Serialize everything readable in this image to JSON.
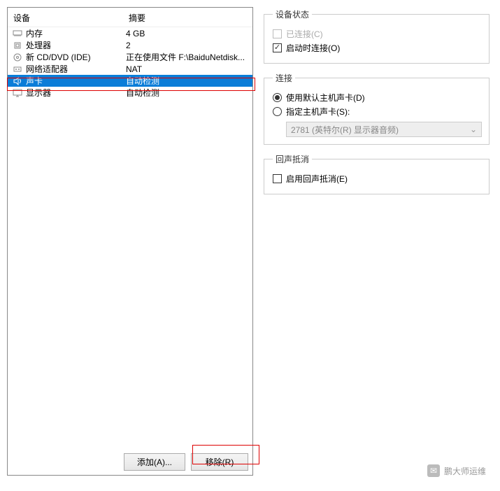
{
  "leftPanel": {
    "headerDevice": "设备",
    "headerSummary": "摘要",
    "rows": [
      {
        "icon": "memory",
        "label": "内存",
        "summary": "4 GB",
        "selected": false
      },
      {
        "icon": "cpu",
        "label": "处理器",
        "summary": "2",
        "selected": false
      },
      {
        "icon": "disc",
        "label": "新 CD/DVD (IDE)",
        "summary": "正在使用文件 F:\\BaiduNetdisk...",
        "selected": false
      },
      {
        "icon": "network",
        "label": "网络适配器",
        "summary": "NAT",
        "selected": false
      },
      {
        "icon": "sound",
        "label": "声卡",
        "summary": "自动检测",
        "selected": true
      },
      {
        "icon": "display",
        "label": "显示器",
        "summary": "自动检测",
        "selected": false
      }
    ],
    "addButton": "添加(A)...",
    "removeButton": "移除(R)"
  },
  "rightPanel": {
    "deviceStatus": {
      "legend": "设备状态",
      "connected": "已连接(C)",
      "connectedChecked": false,
      "connectAtStart": "启动时连接(O)",
      "connectAtStartChecked": true
    },
    "connection": {
      "legend": "连接",
      "defaultHost": "使用默认主机声卡(D)",
      "defaultHostChecked": true,
      "specifyHost": "指定主机声卡(S):",
      "specifyHostChecked": false,
      "comboValue": "2781 (英特尔(R) 显示器音频)"
    },
    "echoCancel": {
      "legend": "回声抵消",
      "enable": "启用回声抵消(E)",
      "enableChecked": false
    }
  },
  "watermark": "鹏大师运维"
}
